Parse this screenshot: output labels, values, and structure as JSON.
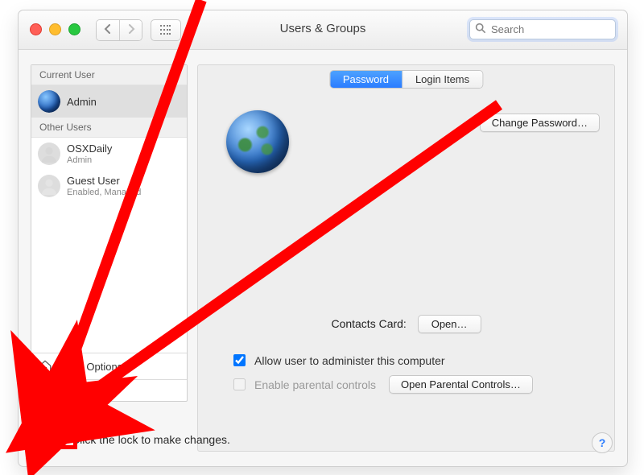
{
  "window": {
    "title": "Users & Groups"
  },
  "search": {
    "placeholder": "Search",
    "value": ""
  },
  "sidebar": {
    "current_header": "Current User",
    "other_header": "Other Users",
    "current": {
      "name": "Admin"
    },
    "others": [
      {
        "name": "OSXDaily",
        "role": "Admin"
      },
      {
        "name": "Guest User",
        "role": "Enabled, Managed"
      }
    ],
    "login_options_label": "Login Options"
  },
  "tabs": {
    "password": "Password",
    "login_items": "Login Items"
  },
  "right": {
    "change_password": "Change Password…",
    "contacts_label": "Contacts Card:",
    "open_label": "Open…",
    "admin_check": "Allow user to administer this computer",
    "parental_check": "Enable parental controls",
    "open_parental": "Open Parental Controls…"
  },
  "footer": {
    "lock_text": "Click the lock to make changes.",
    "help": "?"
  },
  "colors": {
    "accent": "#2a7cff",
    "annotation": "#ff0000"
  }
}
